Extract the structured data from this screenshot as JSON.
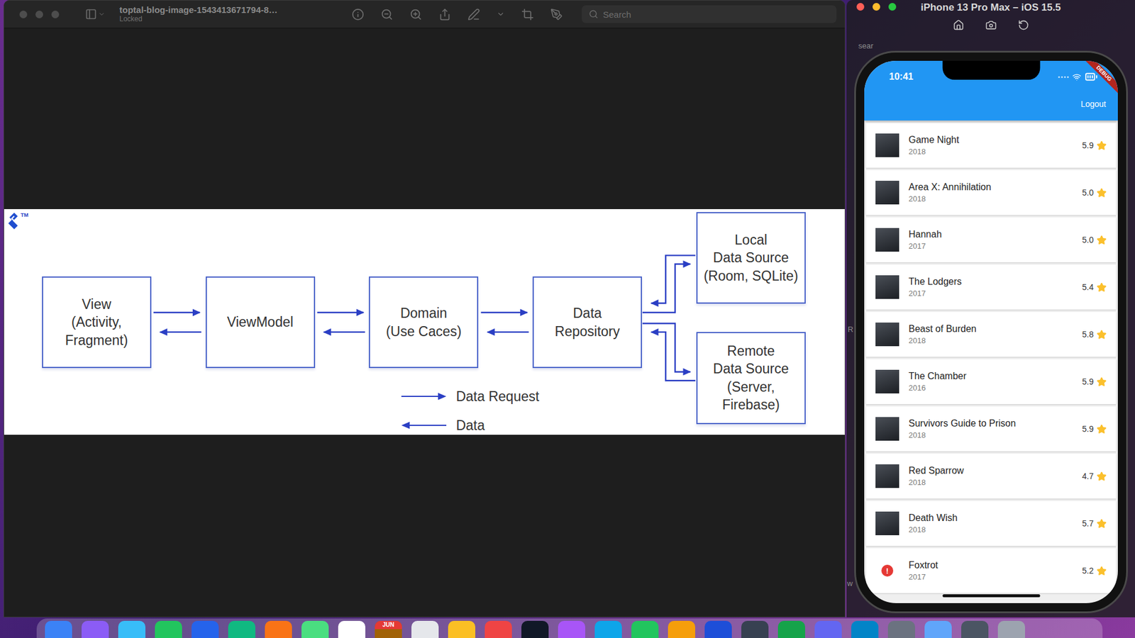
{
  "desktop": {
    "background_fragments": [
      "sear",
      "R",
      "w"
    ]
  },
  "preview": {
    "title": "toptal-blog-image-1543413671794-8…",
    "subtitle": "Locked",
    "search": {
      "placeholder": "Search"
    },
    "diagram": {
      "logo_mark": "TM",
      "nodes": [
        {
          "label": "View\n(Activity,\nFragment)"
        },
        {
          "label": "ViewModel"
        },
        {
          "label": "Domain\n(Use Caces)"
        },
        {
          "label": "Data\nRepository"
        },
        {
          "label": "Local\nData Source\n(Room, SQLite)"
        },
        {
          "label": "Remote\nData Source\n(Server,\nFirebase)"
        }
      ],
      "legend": [
        {
          "label": "Data Request",
          "kind": "request"
        },
        {
          "label": "Data",
          "kind": "data"
        }
      ]
    }
  },
  "simulator": {
    "title": "iPhone 13 Pro Max – iOS 15.5",
    "status_time": "10:41",
    "debug_banner": "DEBUG",
    "app_bar": {
      "action": "Logout"
    },
    "movies": [
      {
        "title": "Game Night",
        "year": "2018",
        "rating": "5.9",
        "kind": "poster"
      },
      {
        "title": "Area X: Annihilation",
        "year": "2018",
        "rating": "5.0",
        "kind": "poster"
      },
      {
        "title": "Hannah",
        "year": "2017",
        "rating": "5.0",
        "kind": "poster"
      },
      {
        "title": "The Lodgers",
        "year": "2017",
        "rating": "5.4",
        "kind": "poster"
      },
      {
        "title": "Beast of Burden",
        "year": "2018",
        "rating": "5.8",
        "kind": "poster"
      },
      {
        "title": "The Chamber",
        "year": "2016",
        "rating": "5.9",
        "kind": "poster"
      },
      {
        "title": "Survivors Guide to Prison",
        "year": "2018",
        "rating": "5.9",
        "kind": "poster"
      },
      {
        "title": "Red Sparrow",
        "year": "2018",
        "rating": "4.7",
        "kind": "poster"
      },
      {
        "title": "Death Wish",
        "year": "2018",
        "rating": "5.7",
        "kind": "poster"
      },
      {
        "title": "Foxtrot",
        "year": "2017",
        "rating": "5.2",
        "kind": "error",
        "icon": "!"
      }
    ]
  },
  "dock": {
    "calendar_month": "JUN"
  }
}
